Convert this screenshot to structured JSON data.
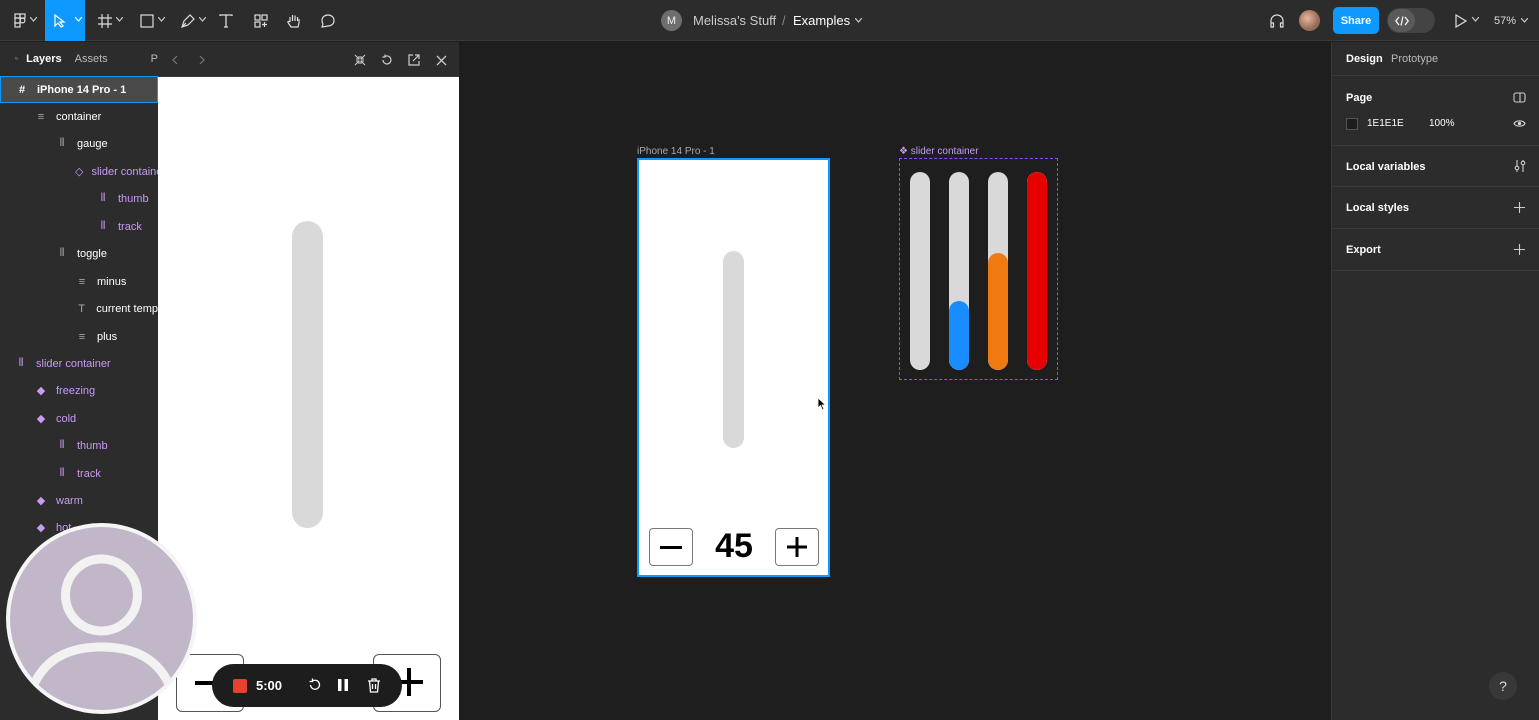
{
  "toolbar": {
    "breadcrumb_owner_initial": "M",
    "breadcrumb_team": "Melissa's Stuff",
    "breadcrumb_separator": "/",
    "breadcrumb_file": "Examples",
    "share_label": "Share",
    "zoom_label": "57%"
  },
  "left_panel": {
    "tabs": [
      "Layers",
      "Assets",
      "P"
    ],
    "layers": [
      {
        "label": "iPhone 14 Pro - 1",
        "icon": "frame-icon"
      },
      {
        "label": "container",
        "icon": "autolayout-vertical-icon"
      },
      {
        "label": "gauge",
        "icon": "autolayout-horizontal-icon"
      },
      {
        "label": "slider container",
        "icon": "instance-icon"
      },
      {
        "label": "thumb",
        "icon": "autolayout-horizontal-icon"
      },
      {
        "label": "track",
        "icon": "autolayout-horizontal-icon"
      },
      {
        "label": "toggle",
        "icon": "autolayout-horizontal-icon"
      },
      {
        "label": "minus",
        "icon": "autolayout-vertical-icon"
      },
      {
        "label": "current temp",
        "icon": "text-icon"
      },
      {
        "label": "plus",
        "icon": "autolayout-vertical-icon"
      },
      {
        "label": "slider container",
        "icon": "component-set-icon"
      },
      {
        "label": "freezing",
        "icon": "variant-icon"
      },
      {
        "label": "cold",
        "icon": "variant-icon"
      },
      {
        "label": "thumb",
        "icon": "autolayout-horizontal-icon"
      },
      {
        "label": "track",
        "icon": "autolayout-horizontal-icon"
      },
      {
        "label": "warm",
        "icon": "variant-icon"
      },
      {
        "label": "hot",
        "icon": "variant-icon"
      }
    ]
  },
  "canvas": {
    "frame_label": "iPhone 14 Pro - 1",
    "component_label": "slider container",
    "current_temp": "45",
    "slider_variants": [
      {
        "name": "freezing",
        "fill_color": "#d9d9d9",
        "fill_fraction": 0
      },
      {
        "name": "cold",
        "fill_color": "#1a8cff",
        "fill_fraction": 0.35
      },
      {
        "name": "warm",
        "fill_color": "#f07a12",
        "fill_fraction": 0.59
      },
      {
        "name": "hot",
        "fill_color": "#e60000",
        "fill_fraction": 1.0
      }
    ]
  },
  "right_panel": {
    "tabs": [
      "Design",
      "Prototype"
    ],
    "page_title": "Page",
    "page_color_hex": "1E1E1E",
    "page_opacity": "100%",
    "local_variables": "Local variables",
    "local_styles": "Local styles",
    "export": "Export",
    "help": "?"
  },
  "recorder": {
    "time": "5:00"
  },
  "colors": {
    "accent": "#0d99ff",
    "component_purple": "#c99bf5",
    "record_red": "#e8412f"
  }
}
